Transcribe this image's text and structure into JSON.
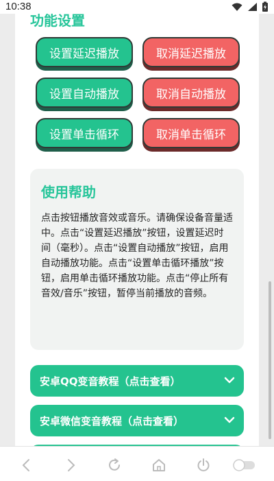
{
  "status": {
    "time": "10:38"
  },
  "section": {
    "title": "功能设置"
  },
  "buttons": {
    "set_delay": "设置延迟播放",
    "cancel_delay": "取消延迟播放",
    "set_auto": "设置自动播放",
    "cancel_auto": "取消自动播放",
    "set_loop": "设置单击循环",
    "cancel_loop": "取消单击循环"
  },
  "help": {
    "title": "使用帮助",
    "text": "点击按钮播放音效或音乐。请确保设备音量适中。点击“设置延迟播放”按钮，设置延迟时间（毫秒）。点击“设置自动播放”按钮，启用自动播放功能。点击“设置单击循环播放”按钮，启用单击循环播放功能。点击“停止所有音效/音乐”按钮，暂停当前播放的音频。"
  },
  "accordions": [
    {
      "label": "安卓QQ变音教程（点击查看）"
    },
    {
      "label": "安卓微信变音教程（点击查看）"
    }
  ],
  "colors": {
    "accent": "#24c38f",
    "danger": "#f26464",
    "title": "#27c59a"
  }
}
